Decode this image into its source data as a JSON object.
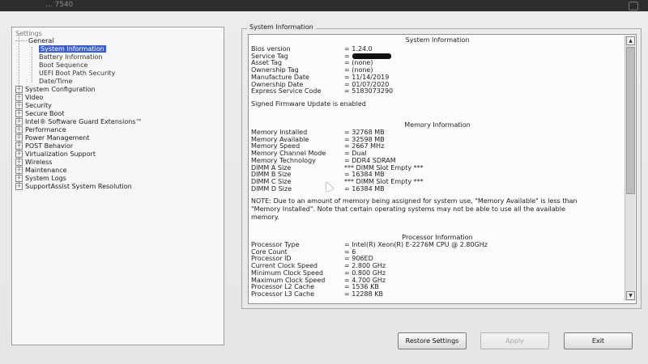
{
  "window": {
    "title": "... 7540"
  },
  "tree": {
    "header": "Settings",
    "items": [
      {
        "label": "General",
        "level": 0,
        "expander": "-"
      },
      {
        "label": "System Information",
        "level": 1,
        "selected": true
      },
      {
        "label": "Battery Information",
        "level": 1
      },
      {
        "label": "Boot Sequence",
        "level": 1
      },
      {
        "label": "UEFI Boot Path Security",
        "level": 1
      },
      {
        "label": "Date/Time",
        "level": 1
      },
      {
        "label": "System Configuration",
        "level": 0,
        "expander": "+"
      },
      {
        "label": "Video",
        "level": 0,
        "expander": "+"
      },
      {
        "label": "Security",
        "level": 0,
        "expander": "+"
      },
      {
        "label": "Secure Boot",
        "level": 0,
        "expander": "+"
      },
      {
        "label": "Intel® Software Guard Extensions™",
        "level": 0,
        "expander": "+"
      },
      {
        "label": "Performance",
        "level": 0,
        "expander": "+"
      },
      {
        "label": "Power Management",
        "level": 0,
        "expander": "+"
      },
      {
        "label": "POST Behavior",
        "level": 0,
        "expander": "+"
      },
      {
        "label": "Virtualization Support",
        "level": 0,
        "expander": "+"
      },
      {
        "label": "Wireless",
        "level": 0,
        "expander": "+"
      },
      {
        "label": "Maintenance",
        "level": 0,
        "expander": "+"
      },
      {
        "label": "System Logs",
        "level": 0,
        "expander": "+"
      },
      {
        "label": "SupportAssist System Resolution",
        "level": 0,
        "expander": "+"
      }
    ]
  },
  "panel": {
    "group_title": "System Information",
    "system_title": "System Information",
    "system_rows": [
      {
        "k": "Bios version",
        "v": "= 1.24.0"
      },
      {
        "k": "Service Tag",
        "v": "=",
        "redacted": true
      },
      {
        "k": "Asset Tag",
        "v": "= (none)"
      },
      {
        "k": "Ownership Tag",
        "v": "= (none)"
      },
      {
        "k": "Manufacture Date",
        "v": "= 11/14/2019"
      },
      {
        "k": "Ownership Date",
        "v": "= 01/07/2020"
      },
      {
        "k": "Express Service Code",
        "v": "= 5183073290"
      }
    ],
    "firmware_note": "Signed Firmware Update is enabled",
    "memory_title": "Memory Information",
    "memory_rows": [
      {
        "k": "Memory Installed",
        "v": "= 32768 MB"
      },
      {
        "k": "Memory Available",
        "v": "= 32598 MB"
      },
      {
        "k": "Memory Speed",
        "v": "= 2667 MHz"
      },
      {
        "k": "Memory Channel Mode",
        "v": "= Dual"
      },
      {
        "k": "Memory Technology",
        "v": "= DDR4 SDRAM"
      },
      {
        "k": "DIMM A Size",
        "v": "*** DIMM Slot Empty ***"
      },
      {
        "k": "DIMM B Size",
        "v": "= 16384 MB"
      },
      {
        "k": "DIMM C Size",
        "v": "*** DIMM Slot Empty ***"
      },
      {
        "k": "DIMM D Size",
        "v": "= 16384 MB"
      }
    ],
    "memory_note": "NOTE: Due to an amount of memory being assigned for system use, \"Memory Available\" is less than \"Memory Installed\". Note that certain operating systems may not be able to use all the available memory.",
    "processor_title": "Processor Information",
    "processor_rows": [
      {
        "k": "Processor Type",
        "v": "= Intel(R) Xeon(R) E-2276M CPU @ 2.80GHz"
      },
      {
        "k": "Core Count",
        "v": "= 6"
      },
      {
        "k": "Processor ID",
        "v": "= 906ED"
      },
      {
        "k": "Current Clock Speed",
        "v": "= 2.800 GHz"
      },
      {
        "k": "Minimum Clock Speed",
        "v": "= 0.800 GHz"
      },
      {
        "k": "Maximum Clock Speed",
        "v": "= 4.700 GHz"
      },
      {
        "k": "Processor L2 Cache",
        "v": "= 1536 KB"
      },
      {
        "k": "Processor L3 Cache",
        "v": "= 12288 KB"
      }
    ]
  },
  "buttons": {
    "restore": "Restore Settings",
    "apply": "Apply",
    "exit": "Exit"
  },
  "icons": {
    "scroll_up": "scroll-up-arrow-icon",
    "scroll_down": "scroll-down-arrow-icon",
    "cursor": "mouse-pointer-icon"
  },
  "colors": {
    "selection": "#3a5fcd",
    "background": "#e9e9e9"
  }
}
